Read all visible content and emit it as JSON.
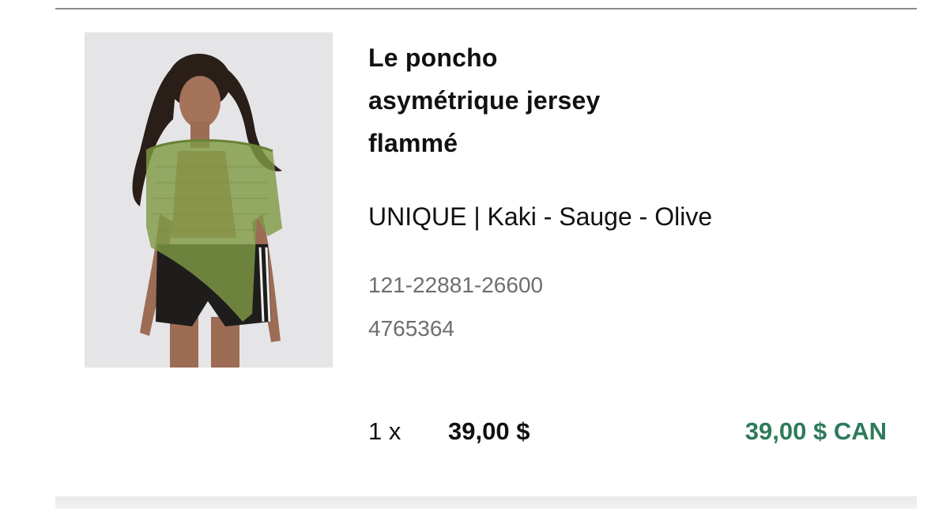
{
  "item": {
    "title_lines": [
      "Le poncho",
      "asymétrique jersey",
      "flammé"
    ],
    "variant": "UNIQUE | Kaki - Sauge - Olive",
    "sku": "121-22881-26600",
    "code": "4765364",
    "quantity": "1 x",
    "unit_price": "39,00 $",
    "total_price": "39,00 $ CAN"
  },
  "colors": {
    "total_price": "#2f7a5c",
    "secondary_text": "#6e6e6e",
    "poncho": "#7f9a45"
  },
  "image": {
    "subject": "model-wearing-olive-knit-poncho"
  }
}
